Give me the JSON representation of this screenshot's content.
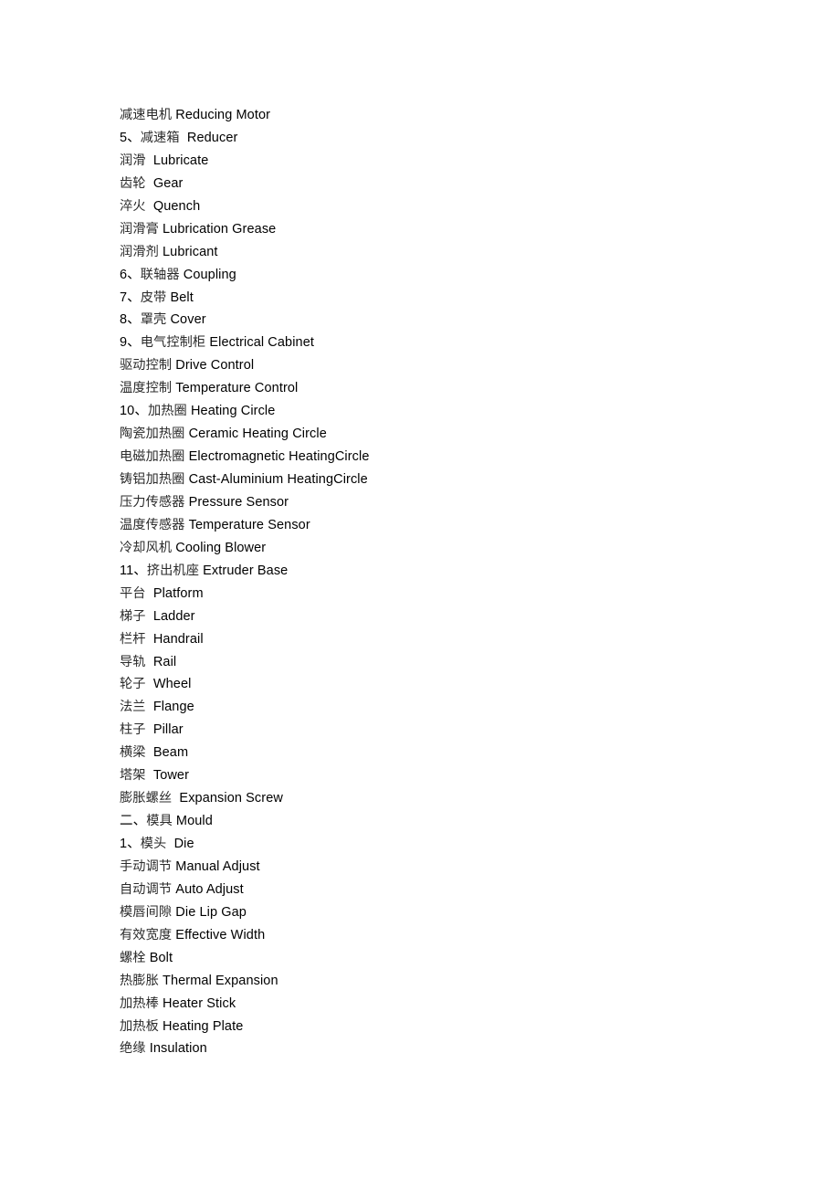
{
  "document": {
    "background_color": "#ffffff",
    "text_color": "#000000",
    "lines": [
      {
        "prefix": "",
        "cn": "减速电机",
        "gap": " ",
        "en": "Reducing Motor"
      },
      {
        "prefix": "5、",
        "cn": "减速箱",
        "gap": "  ",
        "en": "Reducer"
      },
      {
        "prefix": "",
        "cn": "润滑",
        "gap": "  ",
        "en": "Lubricate"
      },
      {
        "prefix": "",
        "cn": "齿轮",
        "gap": "  ",
        "en": "Gear"
      },
      {
        "prefix": "",
        "cn": "淬火",
        "gap": "  ",
        "en": "Quench"
      },
      {
        "prefix": "",
        "cn": "润滑膏",
        "gap": " ",
        "en": "Lubrication Grease"
      },
      {
        "prefix": "",
        "cn": "润滑剂",
        "gap": " ",
        "en": "Lubricant"
      },
      {
        "prefix": "6、",
        "cn": "联轴器",
        "gap": " ",
        "en": "Coupling"
      },
      {
        "prefix": "7、",
        "cn": "皮带",
        "gap": " ",
        "en": "Belt"
      },
      {
        "prefix": "8、",
        "cn": "罩壳",
        "gap": " ",
        "en": "Cover"
      },
      {
        "prefix": "9、",
        "cn": "电气控制柜",
        "gap": " ",
        "en": "Electrical Cabinet"
      },
      {
        "prefix": "",
        "cn": "驱动控制",
        "gap": " ",
        "en": "Drive Control"
      },
      {
        "prefix": "",
        "cn": "温度控制",
        "gap": " ",
        "en": "Temperature Control"
      },
      {
        "prefix": "10、",
        "cn": "加热圈",
        "gap": " ",
        "en": "Heating Circle"
      },
      {
        "prefix": "",
        "cn": "陶瓷加热圈",
        "gap": " ",
        "en": "Ceramic Heating Circle"
      },
      {
        "prefix": "",
        "cn": "电磁加热圈",
        "gap": " ",
        "en": "Electromagnetic HeatingCircle"
      },
      {
        "prefix": "",
        "cn": "铸铝加热圈",
        "gap": " ",
        "en": "Cast-Aluminium HeatingCircle"
      },
      {
        "prefix": "",
        "cn": "压力传感器",
        "gap": " ",
        "en": "Pressure Sensor"
      },
      {
        "prefix": "",
        "cn": "温度传感器",
        "gap": " ",
        "en": "Temperature Sensor"
      },
      {
        "prefix": "",
        "cn": "冷却风机",
        "gap": " ",
        "en": "Cooling Blower"
      },
      {
        "prefix": "11、",
        "cn": "挤出机座",
        "gap": " ",
        "en": "Extruder Base"
      },
      {
        "prefix": "",
        "cn": "平台",
        "gap": "  ",
        "en": "Platform"
      },
      {
        "prefix": "",
        "cn": "梯子",
        "gap": "  ",
        "en": "Ladder"
      },
      {
        "prefix": "",
        "cn": "栏杆",
        "gap": "  ",
        "en": "Handrail"
      },
      {
        "prefix": "",
        "cn": "导轨",
        "gap": "  ",
        "en": "Rail"
      },
      {
        "prefix": "",
        "cn": "轮子",
        "gap": "  ",
        "en": "Wheel"
      },
      {
        "prefix": "",
        "cn": "法兰",
        "gap": "  ",
        "en": "Flange"
      },
      {
        "prefix": "",
        "cn": "柱子",
        "gap": "  ",
        "en": "Pillar"
      },
      {
        "prefix": "",
        "cn": "横梁",
        "gap": "  ",
        "en": "Beam"
      },
      {
        "prefix": "",
        "cn": "塔架",
        "gap": "  ",
        "en": "Tower"
      },
      {
        "prefix": "",
        "cn": "膨胀螺丝",
        "gap": "  ",
        "en": "Expansion Screw"
      },
      {
        "prefix": "二、",
        "cn": "模具",
        "gap": " ",
        "en": "Mould"
      },
      {
        "prefix": "1、",
        "cn": "模头",
        "gap": "  ",
        "en": "Die"
      },
      {
        "prefix": "",
        "cn": "手动调节",
        "gap": " ",
        "en": "Manual Adjust"
      },
      {
        "prefix": "",
        "cn": "自动调节",
        "gap": " ",
        "en": "Auto Adjust"
      },
      {
        "prefix": "",
        "cn": "模唇间隙",
        "gap": " ",
        "en": "Die Lip Gap"
      },
      {
        "prefix": "",
        "cn": "有效宽度",
        "gap": " ",
        "en": "Effective Width"
      },
      {
        "prefix": "",
        "cn": "螺栓",
        "gap": " ",
        "en": "Bolt"
      },
      {
        "prefix": "",
        "cn": "热膨胀",
        "gap": " ",
        "en": "Thermal Expansion"
      },
      {
        "prefix": "",
        "cn": "加热棒",
        "gap": " ",
        "en": "Heater Stick"
      },
      {
        "prefix": "",
        "cn": "加热板",
        "gap": " ",
        "en": "Heating Plate"
      },
      {
        "prefix": "",
        "cn": "绝缘",
        "gap": " ",
        "en": "Insulation"
      }
    ]
  }
}
